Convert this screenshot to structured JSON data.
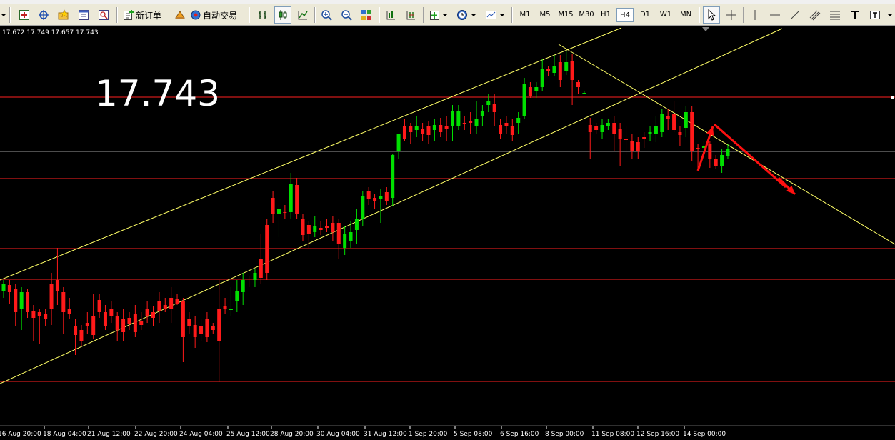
{
  "toolbar": {
    "new_order_label": "新订单",
    "auto_trade_label": "自动交易",
    "timeframes": [
      "M1",
      "M5",
      "M15",
      "M30",
      "H1",
      "H4",
      "D1",
      "W1",
      "MN"
    ],
    "active_timeframe": "H4"
  },
  "chart": {
    "ohlc_readout": "17.672 17.749 17.657 17.743",
    "price_overlay": "17.743",
    "x_labels": [
      "16 Aug 20:00",
      "18 Aug 04:00",
      "21 Aug 12:00",
      "22 Aug 20:00",
      "24 Aug 04:00",
      "25 Aug 12:00",
      "28 Aug 20:00",
      "30 Aug 04:00",
      "31 Aug 12:00",
      "1 Sep 20:00",
      "5 Sep 08:00",
      "6 Sep 16:00",
      "8 Sep 00:00",
      "11 Sep 08:00",
      "12 Sep 16:00",
      "14 Sep 00:00"
    ],
    "colors": {
      "background": "#000000",
      "bull": "#00e000",
      "bear": "#ff1a1a",
      "level_line": "#ff2020",
      "trend_line": "#ffff66",
      "arrow": "#ff1010",
      "bid_line": "#9a9a9a"
    }
  },
  "chart_data": {
    "type": "candlestick",
    "categories": [
      "16 Aug 20:00",
      "18 Aug 04:00",
      "21 Aug 12:00",
      "22 Aug 20:00",
      "24 Aug 04:00",
      "25 Aug 12:00",
      "28 Aug 20:00",
      "30 Aug 04:00",
      "31 Aug 12:00",
      "1 Sep 20:00",
      "5 Sep 08:00",
      "6 Sep 16:00",
      "8 Sep 00:00",
      "11 Sep 08:00",
      "12 Sep 16:00",
      "14 Sep 00:00"
    ],
    "last_ohlc": {
      "open": 17.672,
      "high": 17.749,
      "low": 17.657,
      "close": 17.743
    },
    "current_price": 17.743,
    "horizontal_levels": 6,
    "trend_lines": 3,
    "forecast_arrows": 2,
    "grid": false
  }
}
